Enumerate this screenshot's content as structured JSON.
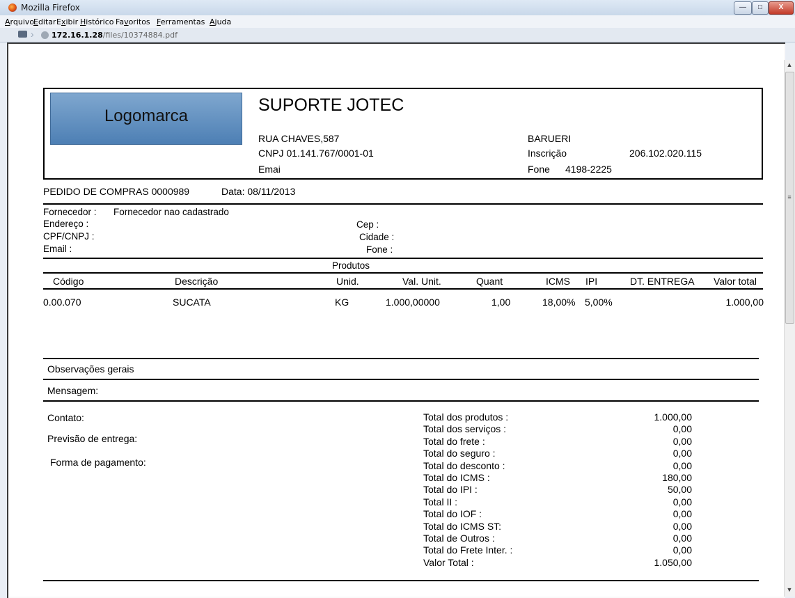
{
  "window": {
    "title": "Mozilla Firefox",
    "buttons": {
      "minimize": "—",
      "maximize": "□",
      "close": "X"
    }
  },
  "menu": [
    "Arquivo",
    "Editar",
    "Exibir",
    "Histórico",
    "Favoritos",
    "Ferramentas",
    "Ajuda"
  ],
  "menu_accel": [
    "A",
    "E",
    "x",
    "H",
    "v",
    "F",
    "A"
  ],
  "address": {
    "host": "172.16.1.28",
    "path": "/files/10374884.pdf"
  },
  "doc": {
    "logo_text": "Logomarca",
    "company": "SUPORTE  JOTEC",
    "street": "RUA CHAVES,587",
    "cnpj": "CNPJ  01.141.767/0001-01",
    "email_label": "Emai",
    "city": "BARUERI",
    "inscricao_label": "Inscrição",
    "inscricao_value": "206.102.020.115",
    "fone_label": "Fone",
    "fone_value": "4198-2225",
    "pedido": "PEDIDO DE COMPRAS  0000989",
    "data": "Data: 08/11/2013",
    "fornecedor_label": "Fornecedor :",
    "fornecedor_value": "Fornecedor nao cadastrado",
    "endereco_label": "Endereço :",
    "cpf_label": "CPF/CNPJ :",
    "email2_label": "Email :",
    "cep_label": "Cep :",
    "cidade_label": "Cidade :",
    "fone2_label": "Fone :",
    "produtos_label": "Produtos",
    "columns": [
      "Código",
      "Descrição",
      "Unid.",
      "Val. Unit.",
      "Quant",
      "ICMS",
      "IPI",
      "DT. ENTREGA",
      "Valor total"
    ],
    "row": {
      "codigo": "0.00.070",
      "descricao": "SUCATA",
      "unid": "KG",
      "val_unit": "1.000,00000",
      "quant": "1,00",
      "icms": "18,00%",
      "ipi": "5,00%",
      "dt_entrega": "",
      "valor_total": "1.000,00"
    },
    "obs_label": "Observações gerais",
    "msg_label": "Mensagem:",
    "contato_label": "Contato:",
    "previsao_label": "Previsão de entrega:",
    "forma_label": "Forma de pagamento:",
    "totals": [
      {
        "label": "Total dos produtos :",
        "value": "1.000,00"
      },
      {
        "label": "Total dos serviços :",
        "value": "0,00"
      },
      {
        "label": "Total do frete :",
        "value": "0,00"
      },
      {
        "label": "Total do seguro :",
        "value": "0,00"
      },
      {
        "label": "Total do desconto :",
        "value": "0,00"
      },
      {
        "label": "Total do ICMS :",
        "value": "180,00"
      },
      {
        "label": "Total do IPI :",
        "value": "50,00"
      },
      {
        "label": "Total II :",
        "value": "0,00"
      },
      {
        "label": "Total do IOF :",
        "value": "0,00"
      },
      {
        "label": "Total do ICMS ST:",
        "value": "0,00"
      },
      {
        "label": "Total de Outros :",
        "value": "0,00"
      },
      {
        "label": "Total do Frete Inter. :",
        "value": "0,00"
      },
      {
        "label": "Valor Total :",
        "value": "1.050,00"
      }
    ]
  }
}
